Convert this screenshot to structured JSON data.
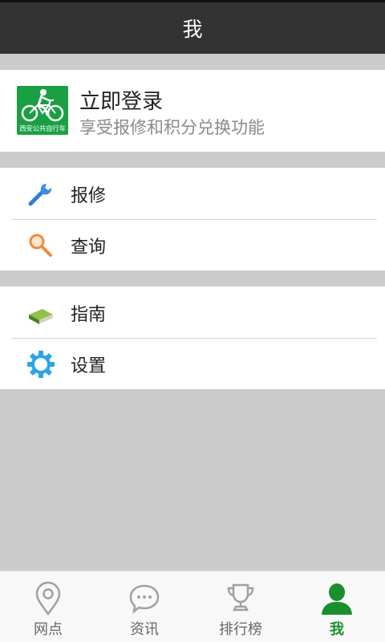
{
  "header": {
    "title": "我"
  },
  "login": {
    "logo_text": "西安公共自行车",
    "title": "立即登录",
    "subtitle": "享受报修和积分兑换功能"
  },
  "menu": {
    "group1": [
      {
        "label": "报修",
        "icon": "wrench-icon"
      },
      {
        "label": "查询",
        "icon": "search-icon"
      }
    ],
    "group2": [
      {
        "label": "指南",
        "icon": "book-icon"
      },
      {
        "label": "设置",
        "icon": "gear-icon"
      }
    ]
  },
  "tabs": [
    {
      "label": "网点",
      "icon": "location-pin-icon",
      "active": false
    },
    {
      "label": "资讯",
      "icon": "chat-bubble-icon",
      "active": false
    },
    {
      "label": "排行榜",
      "icon": "trophy-icon",
      "active": false
    },
    {
      "label": "我",
      "icon": "user-icon",
      "active": true
    }
  ],
  "colors": {
    "header_bg": "#333333",
    "accent_green": "#1a8f2c",
    "logo_green": "#1aa043",
    "background": "#cccccc"
  }
}
